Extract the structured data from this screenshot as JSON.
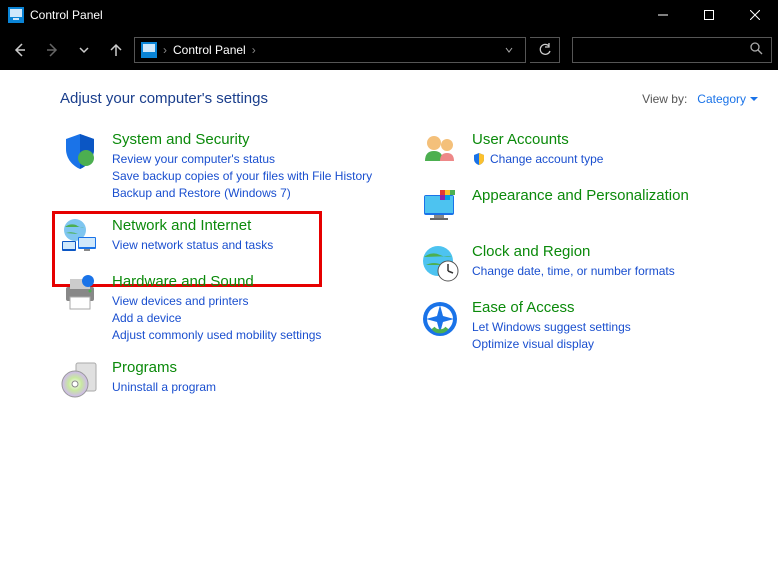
{
  "window": {
    "title": "Control Panel"
  },
  "breadcrumb": {
    "root": "Control Panel"
  },
  "heading": "Adjust your computer's settings",
  "viewby": {
    "label": "View by:",
    "value": "Category"
  },
  "left": [
    {
      "title": "System and Security",
      "subs": [
        "Review your computer's status",
        "Save backup copies of your files with File History",
        "Backup and Restore (Windows 7)"
      ]
    },
    {
      "title": "Network and Internet",
      "subs": [
        "View network status and tasks"
      ],
      "highlight": true
    },
    {
      "title": "Hardware and Sound",
      "subs": [
        "View devices and printers",
        "Add a device",
        "Adjust commonly used mobility settings"
      ]
    },
    {
      "title": "Programs",
      "subs": [
        "Uninstall a program"
      ]
    }
  ],
  "right": [
    {
      "title": "User Accounts",
      "subs_shield": [
        "Change account type"
      ]
    },
    {
      "title": "Appearance and Personalization",
      "subs": []
    },
    {
      "title": "Clock and Region",
      "subs": [
        "Change date, time, or number formats"
      ]
    },
    {
      "title": "Ease of Access",
      "subs": [
        "Let Windows suggest settings",
        "Optimize visual display"
      ]
    }
  ]
}
